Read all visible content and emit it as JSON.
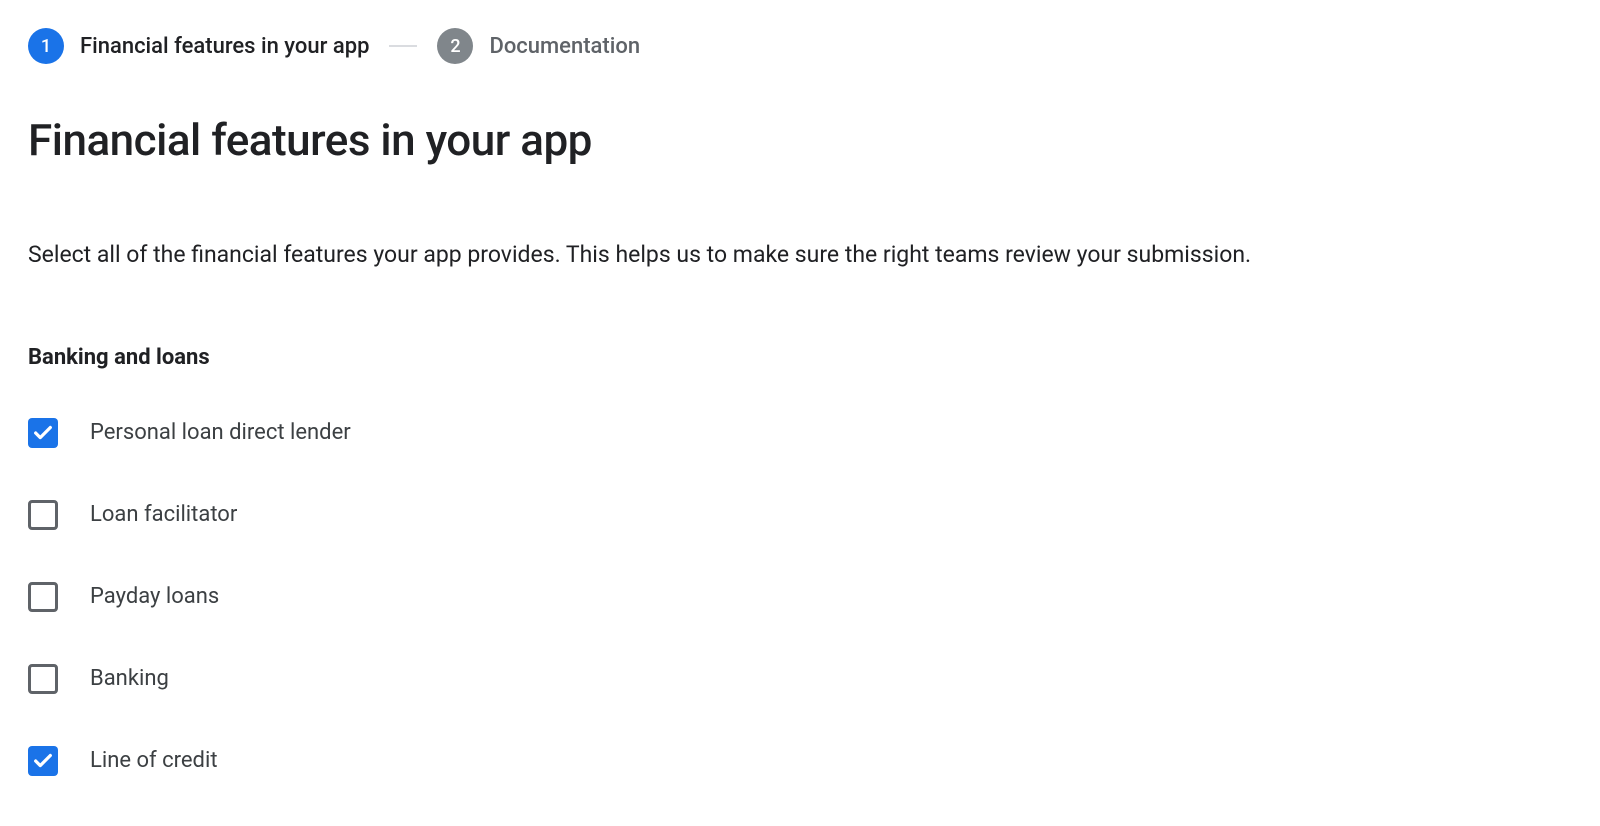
{
  "stepper": {
    "steps": [
      {
        "number": "1",
        "label": "Financial features in your app",
        "active": true
      },
      {
        "number": "2",
        "label": "Documentation",
        "active": false
      }
    ]
  },
  "page": {
    "title": "Financial features in your app",
    "description": "Select all of the financial features your app provides. This helps us to make sure the right teams review your submission."
  },
  "section": {
    "header": "Banking and loans",
    "options": [
      {
        "label": "Personal loan direct lender",
        "checked": true
      },
      {
        "label": "Loan facilitator",
        "checked": false
      },
      {
        "label": "Payday loans",
        "checked": false
      },
      {
        "label": "Banking",
        "checked": false
      },
      {
        "label": "Line of credit",
        "checked": true
      }
    ]
  }
}
